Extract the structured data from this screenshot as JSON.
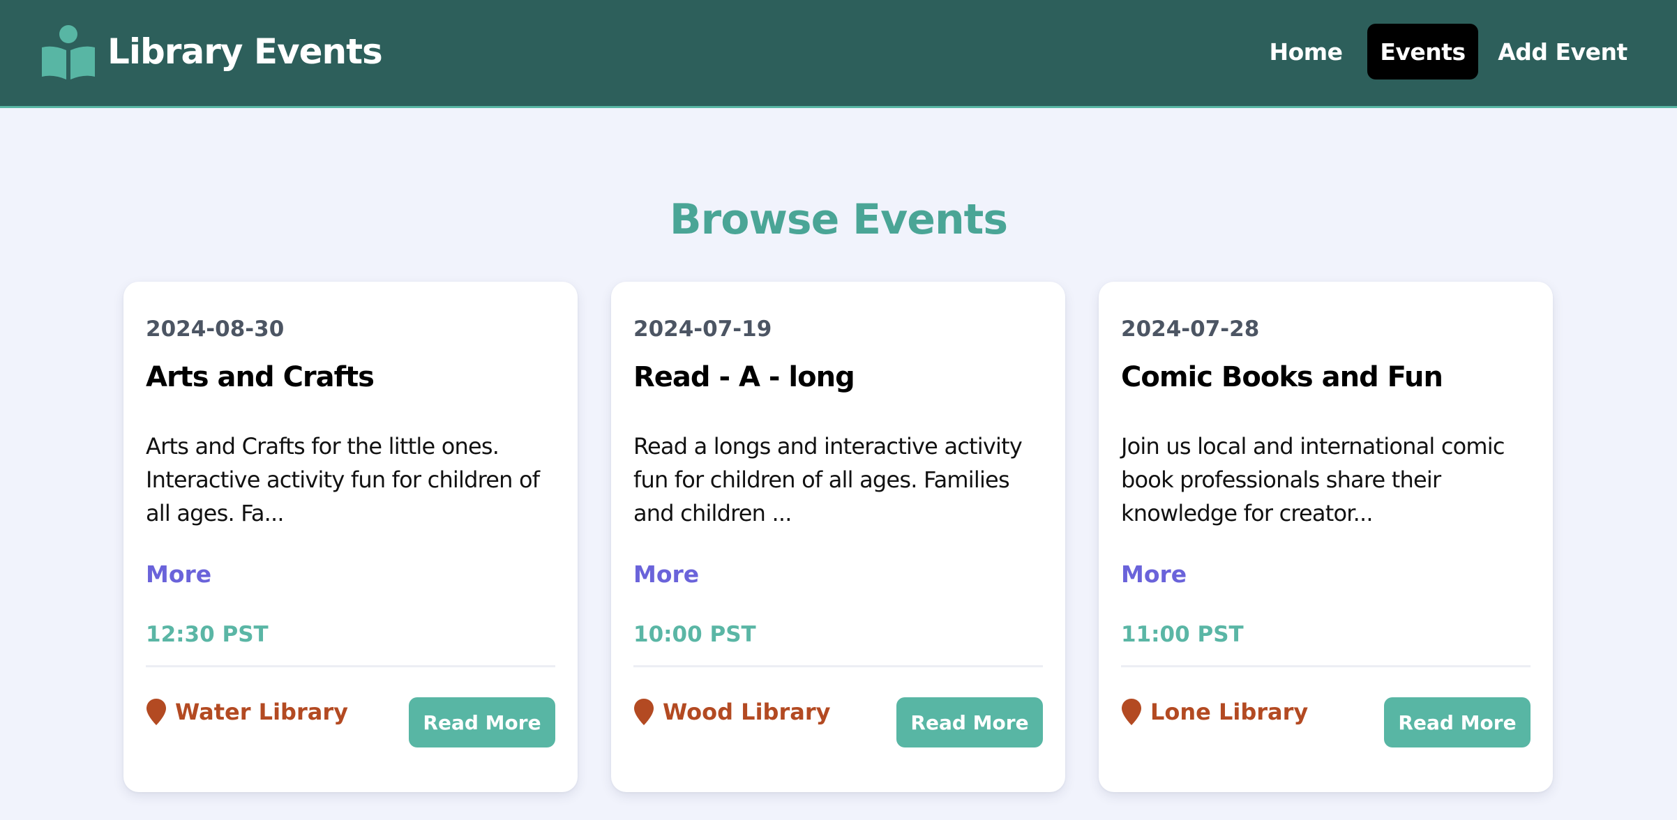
{
  "brand": {
    "title": "Library Events",
    "icon": "reader-book-icon",
    "icon_color": "#58b6a4"
  },
  "nav": {
    "items": [
      {
        "label": "Home",
        "active": false
      },
      {
        "label": "Events",
        "active": true
      },
      {
        "label": "Add Event",
        "active": false
      }
    ]
  },
  "page": {
    "title": "Browse Events"
  },
  "events": [
    {
      "date": "2024-08-30",
      "title": "Arts and Crafts",
      "description": "Arts and Crafts for the little ones. Interactive activity fun for children of all ages. Fa...",
      "more_label": "More",
      "time": "12:30 PST",
      "location": "Water Library",
      "location_icon": "map-pin-icon",
      "button_label": "Read More"
    },
    {
      "date": "2024-07-19",
      "title": "Read - A - long",
      "description": "Read a longs and interactive activity fun for children of all ages. Families and children ...",
      "more_label": "More",
      "time": "10:00 PST",
      "location": "Wood Library",
      "location_icon": "map-pin-icon",
      "button_label": "Read More"
    },
    {
      "date": "2024-07-28",
      "title": "Comic Books and Fun",
      "description": "Join us local and international comic book professionals share their knowledge for creator...",
      "more_label": "More",
      "time": "11:00 PST",
      "location": "Lone Library",
      "location_icon": "map-pin-icon",
      "button_label": "Read More"
    }
  ],
  "colors": {
    "header_bg": "#2d5f5b",
    "accent_teal": "#58b6a4",
    "title_teal": "#4aa596",
    "link_purple": "#6a63da",
    "location_rust": "#b34a22",
    "page_bg": "#f1f3fc",
    "active_nav_bg": "#000000"
  }
}
